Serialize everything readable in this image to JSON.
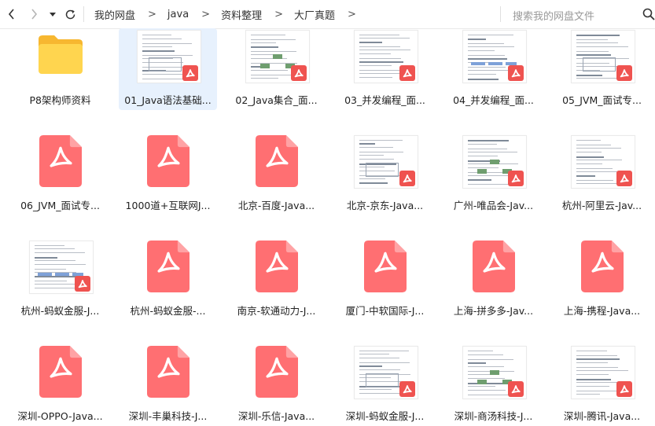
{
  "toolbar": {
    "icons": {
      "back": "chevron-left-icon",
      "forward": "chevron-right-icon",
      "history": "caret-down-icon",
      "refresh": "refresh-icon",
      "search": "search-icon"
    },
    "breadcrumb": [
      "我的网盘",
      "java",
      "资料整理",
      "大厂真题"
    ],
    "breadcrumb_separator": ">",
    "search_placeholder": "搜索我的网盘文件"
  },
  "colors": {
    "pdf_red": "#ff6f72",
    "folder_yellow": "#ffd54f",
    "selected_bg": "#e7f1fd"
  },
  "files": [
    {
      "name": "P8架构师资料",
      "type": "folder"
    },
    {
      "name": "01_Java语法基础...",
      "type": "pdf-preview",
      "selected": true
    },
    {
      "name": "02_Java集合_面...",
      "type": "pdf-preview"
    },
    {
      "name": "03_并发编程_面...",
      "type": "pdf-preview"
    },
    {
      "name": "04_并发编程_面...",
      "type": "pdf-preview"
    },
    {
      "name": "05_JVM_面试专...",
      "type": "pdf-preview"
    },
    {
      "name": "06_JVM_面试专...",
      "type": "pdf"
    },
    {
      "name": "1000道+互联网J...",
      "type": "pdf"
    },
    {
      "name": "北京-百度-Java...",
      "type": "pdf"
    },
    {
      "name": "北京-京东-Java...",
      "type": "pdf-preview"
    },
    {
      "name": "广州-唯品会-Jav...",
      "type": "pdf-preview"
    },
    {
      "name": "杭州-阿里云-Jav...",
      "type": "pdf-preview"
    },
    {
      "name": "杭州-蚂蚁金服-J...",
      "type": "pdf-preview"
    },
    {
      "name": "杭州-蚂蚁金服-...",
      "type": "pdf"
    },
    {
      "name": "南京-软通动力-J...",
      "type": "pdf"
    },
    {
      "name": "厦门-中软国际-J...",
      "type": "pdf"
    },
    {
      "name": "上海-拼多多-Jav...",
      "type": "pdf"
    },
    {
      "name": "上海-携程-Java...",
      "type": "pdf"
    },
    {
      "name": "深圳-OPPO-Java...",
      "type": "pdf"
    },
    {
      "name": "深圳-丰巢科技-J...",
      "type": "pdf"
    },
    {
      "name": "深圳-乐信-Java...",
      "type": "pdf"
    },
    {
      "name": "深圳-蚂蚁金服-J...",
      "type": "pdf-preview"
    },
    {
      "name": "深圳-商汤科技-J...",
      "type": "pdf-preview"
    },
    {
      "name": "深圳-腾讯-Java...",
      "type": "pdf-preview"
    }
  ]
}
